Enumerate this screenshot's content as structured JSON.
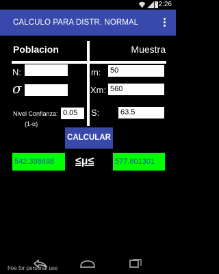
{
  "status": {
    "time": "2:26"
  },
  "app": {
    "title": "CALCULO PARA DISTR. NORMAL"
  },
  "header": {
    "left": "Poblacion",
    "right": "Muestra"
  },
  "fields": {
    "n_label": "N:",
    "n_value": "",
    "sigma_label": "σ",
    "sigma_value": "",
    "m_label": "m:",
    "m_value": "50",
    "xm_label": "Xm:",
    "xm_value": "560",
    "s_label": "S:",
    "s_value": "63.5",
    "confidence_label": "Nivel Confianza:",
    "confidence_sub": "(1-α)",
    "confidence_value": "0.05"
  },
  "calculate_button": "CALCULAR",
  "results": {
    "lower": "542.398698",
    "upper": "577.601301",
    "mu_label": "≤μ≤"
  },
  "watermark": "free for personal use",
  "icons": [
    "wifi-icon",
    "signal-icon",
    "battery-icon",
    "overflow-menu-icon",
    "back-icon",
    "home-icon",
    "recents-icon"
  ]
}
